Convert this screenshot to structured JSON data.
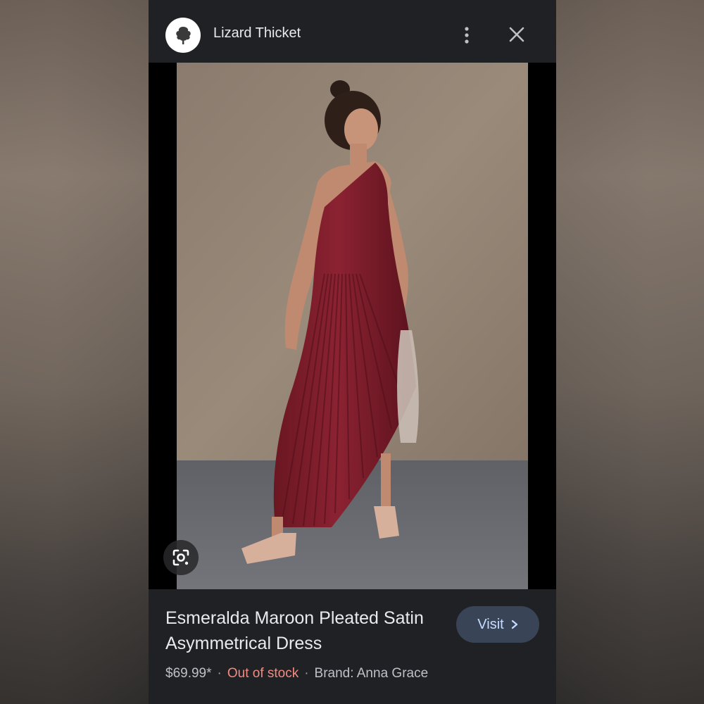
{
  "header": {
    "site_name": "Lizard Thicket",
    "logo_icon": "tree-logo-icon",
    "more_icon": "more-vert-icon",
    "close_icon": "close-icon"
  },
  "image": {
    "lens_icon": "google-lens-icon"
  },
  "product": {
    "title": "Esmeralda Maroon Pleated Satin Asymmetrical Dress",
    "price": "$69.99*",
    "stock": "Out of stock",
    "brand": "Brand: Anna Grace",
    "separator": "·"
  },
  "actions": {
    "visit_label": "Visit",
    "visit_icon": "chevron-right-icon"
  },
  "colors": {
    "panel_bg": "#202124",
    "visit_bg": "#394457",
    "visit_text": "#c7dcff",
    "stock_text": "#f28b82",
    "dress": "#7b1e2b"
  }
}
